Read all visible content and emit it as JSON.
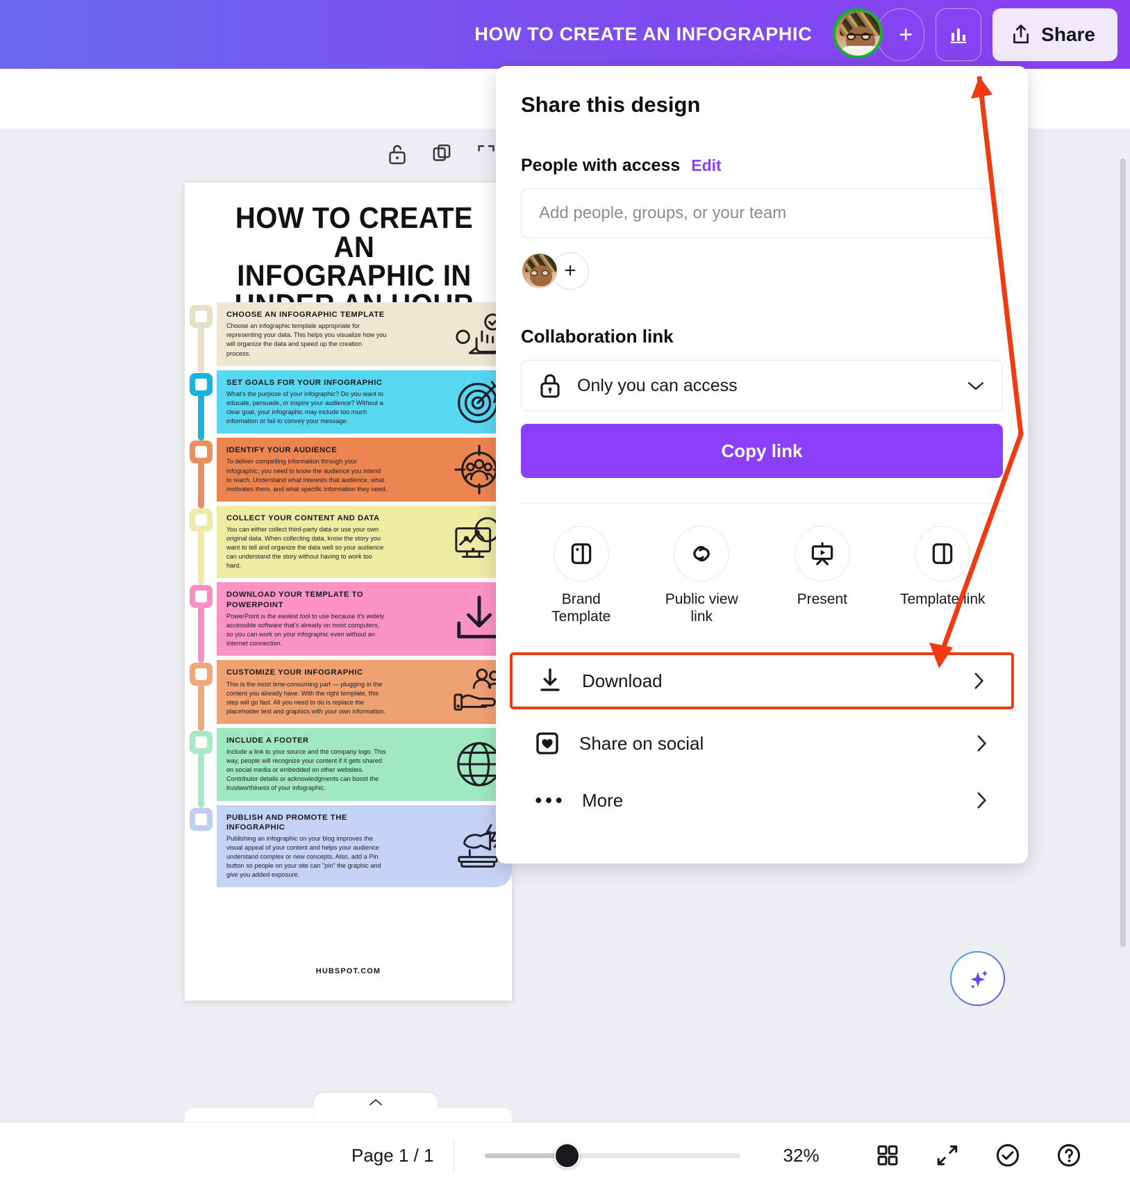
{
  "topbar": {
    "doc_title": "HOW TO CREATE AN INFOGRAPHIC",
    "avatar_name": "user-avatar",
    "plus_label": "+",
    "share_label": "Share",
    "accent": "#8b3ffb"
  },
  "share_panel": {
    "title": "Share this design",
    "people_section_label": "People with access",
    "edit_label": "Edit",
    "people_input_placeholder": "Add people, groups, or your team",
    "add_person_label": "+",
    "collaboration_label": "Collaboration link",
    "access_value": "Only you can access",
    "copy_link_label": "Copy link",
    "quick_actions": [
      {
        "label": "Brand Template",
        "icon": "brand-template-icon"
      },
      {
        "label": "Public view link",
        "icon": "public-link-icon"
      },
      {
        "label": "Present",
        "icon": "present-icon"
      },
      {
        "label": "Template link",
        "icon": "template-link-icon"
      }
    ],
    "menu_items": [
      {
        "label": "Download",
        "icon": "download-icon",
        "highlighted": true
      },
      {
        "label": "Share on social",
        "icon": "heart-icon",
        "highlighted": false
      },
      {
        "label": "More",
        "icon": "more-dots-icon",
        "highlighted": false
      }
    ],
    "highlight_color": "#f03a11"
  },
  "bottombar": {
    "page_indicator": "Page 1 / 1",
    "zoom_value": "32%",
    "icons": [
      "grid-view-icon",
      "fullscreen-icon",
      "check-circle-icon",
      "help-icon"
    ]
  },
  "infographic": {
    "title_lines": [
      "HOW TO CREATE AN",
      "INFOGRAPHIC IN",
      "UNDER AN HOUR"
    ],
    "footer": "HUBSPOT.COM",
    "steps": [
      {
        "heading": "CHOOSE AN INFOGRAPHIC TEMPLATE",
        "body": "Choose an infographic template appropriate for representing your data. This helps you visualize how you will organize the data and speed up the creation process.",
        "color": "#efe7cf",
        "node_color": "#e8e0c6",
        "icon": "cursor-check-icon"
      },
      {
        "heading": "SET GOALS FOR YOUR INFOGRAPHIC",
        "body": "What's the purpose of your infographic? Do you want to educate, persuade, or inspire your audience? Without a clear goal, your infographic may include too much information or fail to convey your message.",
        "color": "#58d7f2",
        "node_color": "#19b4dd",
        "icon": "target-icon"
      },
      {
        "heading": "IDENTIFY YOUR AUDIENCE",
        "body": "To deliver compelling information through your infographic, you need to know the audience you intend to reach. Understand what interests that audience, what motivates them, and what specific information they need.",
        "color": "#ed8551",
        "node_color": "#ed8e5e",
        "icon": "audience-target-icon"
      },
      {
        "heading": "COLLECT YOUR CONTENT AND DATA",
        "body": "You can either collect third-party data or use your own original data. When collecting data, know the story you want to tell and organize the data well so your audience can understand the story without having to work too hard.",
        "color": "#eeeba3",
        "node_color": "#efe9a8",
        "icon": "monitor-chart-icon"
      },
      {
        "heading": "DOWNLOAD YOUR TEMPLATE TO POWERPOINT",
        "body": "PowerPoint is the easiest tool to use because it's widely accessible software that's already on most computers, so you can work on your infographic even without an internet connection.",
        "color": "#fc93c6",
        "node_color": "#fa8ec2",
        "icon": "download-arrow-icon"
      },
      {
        "heading": "CUSTOMIZE YOUR INFOGRAPHIC",
        "body": "This is the most time-consuming part — plugging in the content you already have. With the right template, this step will go fast. All you need to do is replace the placeholder text and graphics with your own information.",
        "color": "#f0a172",
        "node_color": "#f0a779",
        "icon": "hand-people-icon"
      },
      {
        "heading": "INCLUDE A FOOTER",
        "body": "Include a link to your source and the company logo. This way, people will recognize your content if it gets shared on social media or embedded on other websites. Contributor details or acknowledgments can boost the trustworthiness of your infographic.",
        "color": "#9fe8c2",
        "node_color": "#a5e9c6",
        "icon": "globe-icon"
      },
      {
        "heading": "PUBLISH AND PROMOTE THE INFOGRAPHIC",
        "body": "Publishing an infographic on your blog improves the visual appeal of your content and helps your audience understand complex or new concepts. Also, add a Pin button so people on your site can \"pin\" the graphic and give you added exposure.",
        "color": "#c5d3f7",
        "node_color": "#c0cef5",
        "icon": "megaphone-books-icon"
      }
    ]
  }
}
